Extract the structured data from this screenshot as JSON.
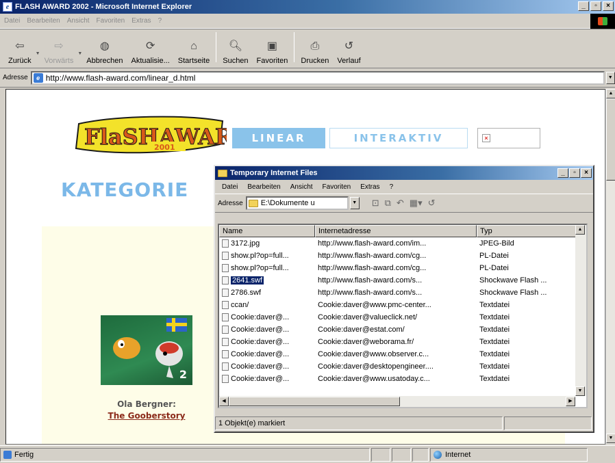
{
  "browser": {
    "title": "FLASH AWARD 2002 - Microsoft Internet Explorer",
    "menu": [
      "Datei",
      "Bearbeiten",
      "Ansicht",
      "Favoriten",
      "Extras",
      "?"
    ],
    "toolbar": {
      "back": "Zurück",
      "forward": "Vorwärts",
      "stop": "Abbrechen",
      "refresh": "Aktualisie...",
      "home": "Startseite",
      "search": "Suchen",
      "favorites": "Favoriten",
      "print": "Drucken",
      "history": "Verlauf"
    },
    "address_label": "Adresse",
    "address_value": "http://www.flash-award.com/linear_d.html",
    "status_text": "Fertig",
    "zone_text": "Internet"
  },
  "page": {
    "logo_text": "FlaSHAWARD",
    "logo_year": "2001",
    "tab_linear": "LINEAR",
    "tab_interaktiv": "INTERAKTIV",
    "heading": "KATEGORIE",
    "thumb_number": "2",
    "author": "Ola Bergner:",
    "title_link": "The Gooberstory"
  },
  "explorer": {
    "title": "Temporary Internet Files",
    "menu": [
      "Datei",
      "Bearbeiten",
      "Ansicht",
      "Favoriten",
      "Extras",
      "?"
    ],
    "address_label": "Adresse",
    "address_value": "E:\\Dokumente u",
    "columns": [
      "Name",
      "Internetadresse",
      "Typ"
    ],
    "rows": [
      {
        "name": "3172.jpg",
        "url": "http://www.flash-award.com/im...",
        "type": "JPEG-Bild"
      },
      {
        "name": "show.pl?op=full...",
        "url": "http://www.flash-award.com/cg...",
        "type": "PL-Datei"
      },
      {
        "name": "show.pl?op=full...",
        "url": "http://www.flash-award.com/cg...",
        "type": "PL-Datei"
      },
      {
        "name": "2641.swf",
        "url": "http://www.flash-award.com/s...",
        "type": "Shockwave Flash ..."
      },
      {
        "name": "2786.swf",
        "url": "http://www.flash-award.com/s...",
        "type": "Shockwave Flash ..."
      },
      {
        "name": "ccan/",
        "url": "Cookie:daver@www.pmc-center...",
        "type": "Textdatei"
      },
      {
        "name": "Cookie:daver@...",
        "url": "Cookie:daver@valueclick.net/",
        "type": "Textdatei"
      },
      {
        "name": "Cookie:daver@...",
        "url": "Cookie:daver@estat.com/",
        "type": "Textdatei"
      },
      {
        "name": "Cookie:daver@...",
        "url": "Cookie:daver@weborama.fr/",
        "type": "Textdatei"
      },
      {
        "name": "Cookie:daver@...",
        "url": "Cookie:daver@www.observer.c...",
        "type": "Textdatei"
      },
      {
        "name": "Cookie:daver@...",
        "url": "Cookie:daver@desktopengineer....",
        "type": "Textdatei"
      },
      {
        "name": "Cookie:daver@...",
        "url": "Cookie:daver@www.usatoday.c...",
        "type": "Textdatei"
      }
    ],
    "status_text": "1 Objekt(e) markiert"
  }
}
